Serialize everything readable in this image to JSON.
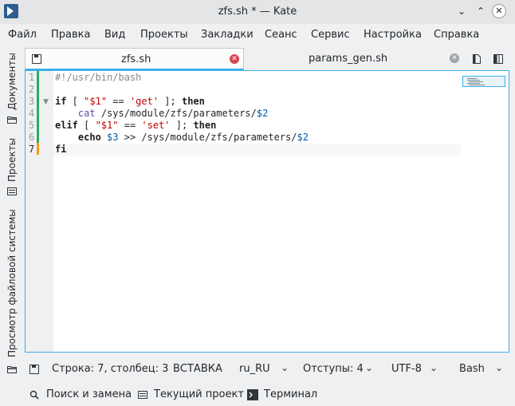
{
  "window": {
    "title": "zfs.sh * — Kate"
  },
  "menubar": {
    "items": [
      "Файл",
      "Правка",
      "Вид",
      "Проекты",
      "Закладки",
      "Сеанс",
      "Сервис",
      "Настройка",
      "Справка"
    ]
  },
  "sidebar": {
    "tabs": [
      "Документы",
      "Проекты",
      "Просмотр файловой системы"
    ]
  },
  "tabs": [
    {
      "label": "zfs.sh",
      "active": true,
      "modified": true
    },
    {
      "label": "params_gen.sh",
      "active": false,
      "modified": false
    }
  ],
  "editor": {
    "line_numbers": [
      "1",
      "2",
      "3",
      "4",
      "5",
      "6",
      "7"
    ],
    "current_line": 7,
    "lines": [
      [
        {
          "t": "#!/usr/bin/bash",
          "c": "cm"
        }
      ],
      [],
      [
        {
          "t": "if",
          "c": "kw"
        },
        {
          "t": " [ ",
          "c": ""
        },
        {
          "t": "\"$1\"",
          "c": "str"
        },
        {
          "t": " == ",
          "c": ""
        },
        {
          "t": "'get'",
          "c": "str"
        },
        {
          "t": " ]; ",
          "c": ""
        },
        {
          "t": "then",
          "c": "kw"
        }
      ],
      [
        {
          "t": "    ",
          "c": ""
        },
        {
          "t": "cat",
          "c": "blt"
        },
        {
          "t": " /sys/module/zfs/parameters/",
          "c": ""
        },
        {
          "t": "$2",
          "c": "var"
        }
      ],
      [
        {
          "t": "elif",
          "c": "kw"
        },
        {
          "t": " [ ",
          "c": ""
        },
        {
          "t": "\"$1\"",
          "c": "str"
        },
        {
          "t": " == ",
          "c": ""
        },
        {
          "t": "'set'",
          "c": "str"
        },
        {
          "t": " ]; ",
          "c": ""
        },
        {
          "t": "then",
          "c": "kw"
        }
      ],
      [
        {
          "t": "    ",
          "c": ""
        },
        {
          "t": "echo",
          "c": "kw"
        },
        {
          "t": " ",
          "c": ""
        },
        {
          "t": "$3",
          "c": "var"
        },
        {
          "t": " >> /sys/module/zfs/parameters/",
          "c": ""
        },
        {
          "t": "$2",
          "c": "var"
        }
      ],
      [
        {
          "t": "fi",
          "c": "kw"
        }
      ]
    ]
  },
  "statusbar": {
    "position": "Строка: 7, столбец: 3",
    "mode": "ВСТАВКА",
    "dictionary": "ru_RU",
    "indent": "Отступы: 4",
    "encoding": "UTF-8",
    "syntax": "Bash"
  },
  "bottombar": {
    "search": "Поиск и замена",
    "project": "Текущий проект",
    "terminal": "Терминал"
  },
  "colors": {
    "accent": "#3daee9",
    "changed_line": "#27ae60",
    "modified_line": "#f39c1f",
    "close_red": "#da4453"
  },
  "icons": {
    "app": "kate-icon",
    "minimize": "chevron-down-icon",
    "maximize": "chevron-up-icon",
    "close": "close-icon",
    "save": "save-icon",
    "folder": "folder-icon",
    "search": "search-icon",
    "terminal": "terminal-icon"
  }
}
